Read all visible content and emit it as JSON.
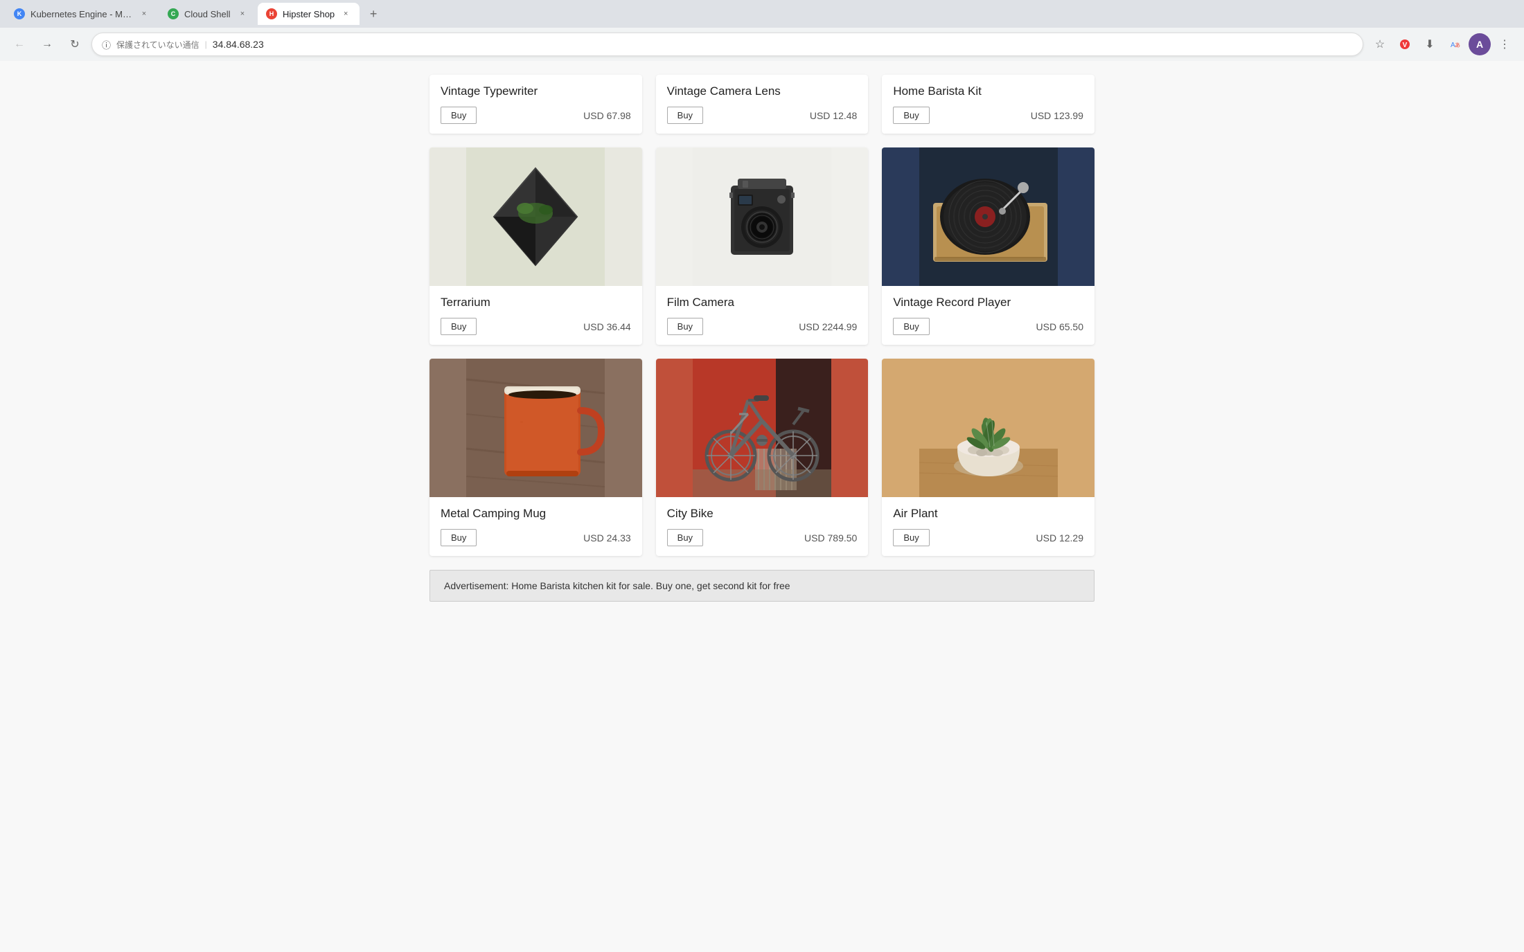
{
  "browser": {
    "tabs": [
      {
        "id": "tab1",
        "title": "Kubernetes Engine - My Proje...",
        "favicon_color": "#4285F4",
        "favicon_letter": "K",
        "active": false
      },
      {
        "id": "tab2",
        "title": "Cloud Shell",
        "favicon_color": "#34A853",
        "favicon_letter": "C",
        "active": false
      },
      {
        "id": "tab3",
        "title": "Hipster Shop",
        "favicon_color": "#EA4335",
        "favicon_letter": "H",
        "active": true
      }
    ],
    "address_warning": "保護されていない通信",
    "address_url": "34.84.68.23",
    "new_tab_label": "+"
  },
  "top_row_products": [
    {
      "id": "p1",
      "name": "Vintage Typewriter",
      "price": "USD 67.98",
      "buy_label": "Buy"
    },
    {
      "id": "p2",
      "name": "Vintage Camera Lens",
      "price": "USD 12.48",
      "buy_label": "Buy"
    },
    {
      "id": "p3",
      "name": "Home Barista Kit",
      "price": "USD 123.99",
      "buy_label": "Buy"
    }
  ],
  "products": [
    {
      "id": "terrarium",
      "name": "Terrarium",
      "price": "USD 36.44",
      "buy_label": "Buy",
      "image_type": "terrarium"
    },
    {
      "id": "film-camera",
      "name": "Film Camera",
      "price": "USD 2244.99",
      "buy_label": "Buy",
      "image_type": "film-camera"
    },
    {
      "id": "vintage-record-player",
      "name": "Vintage Record Player",
      "price": "USD 65.50",
      "buy_label": "Buy",
      "image_type": "record-player"
    },
    {
      "id": "metal-camping-mug",
      "name": "Metal Camping Mug",
      "price": "USD 24.33",
      "buy_label": "Buy",
      "image_type": "coffee-mug"
    },
    {
      "id": "city-bike",
      "name": "City Bike",
      "price": "USD 789.50",
      "buy_label": "Buy",
      "image_type": "city-bike"
    },
    {
      "id": "air-plant",
      "name": "Air Plant",
      "price": "USD 12.29",
      "buy_label": "Buy",
      "image_type": "air-plant"
    }
  ],
  "advertisement": {
    "text": "Advertisement: Home Barista kitchen kit for sale. Buy one, get second kit for free"
  }
}
